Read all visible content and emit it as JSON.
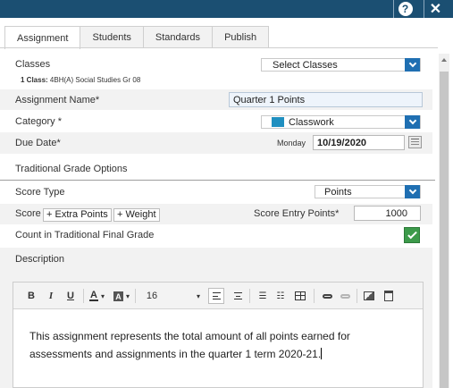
{
  "header": {
    "help_label": "?",
    "close_label": "✕"
  },
  "tabs": [
    {
      "label": "Assignment",
      "active": true
    },
    {
      "label": "Students",
      "active": false
    },
    {
      "label": "Standards",
      "active": false
    },
    {
      "label": "Publish",
      "active": false
    }
  ],
  "form": {
    "classes_label": "Classes",
    "classes_select": "Select Classes",
    "classes_summary_bold": "1 Class:",
    "classes_summary_text": "4BH(A) Social Studies Gr 08",
    "assignment_name_label": "Assignment Name*",
    "assignment_name_value": "Quarter 1 Points",
    "category_label": "Category *",
    "category_value": "Classwork",
    "category_color": "#1f8fc0",
    "due_date_label": "Due Date*",
    "due_day": "Monday",
    "due_date_value": "10/19/2020",
    "traditional_heading": "Traditional Grade Options",
    "score_type_label": "Score Type",
    "score_type_value": "Points",
    "score_label": "Score",
    "extra_points_button": "+ Extra Points",
    "weight_button": "+ Weight",
    "score_entry_label": "Score Entry Points*",
    "score_entry_value": "1000",
    "count_label": "Count in Traditional Final Grade",
    "count_checked": true,
    "description_label": "Description"
  },
  "editor": {
    "bold": "B",
    "italic": "I",
    "underline": "U",
    "font_color": "A",
    "highlight": "A",
    "font_size": "16",
    "content": "This assignment represents the total amount of all points earned for assessments and assignments in the quarter 1 term 2020-21."
  },
  "colors": {
    "title_bar": "#1b4f72",
    "accent_blue": "#1f6fb2",
    "check_green": "#3c9a4a"
  }
}
